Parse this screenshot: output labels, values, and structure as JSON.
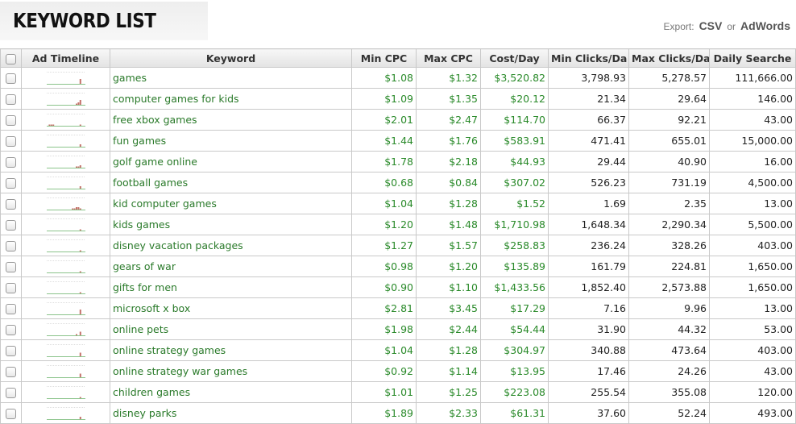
{
  "header": {
    "title": "KEYWORD LIST",
    "export_label": "Export:",
    "export_csv": "CSV",
    "export_or": "or",
    "export_adwords": "AdWords"
  },
  "columns": [
    "Ad Timeline",
    "Keyword",
    "Min CPC",
    "Max CPC",
    "Cost/Day",
    "Min Clicks/Da",
    "Max Clicks/Da",
    "Daily Searche"
  ],
  "rows": [
    {
      "keyword": "games",
      "min_cpc": "$1.08",
      "max_cpc": "$1.32",
      "cost_day": "$3,520.82",
      "min_clicks": "3,798.93",
      "max_clicks": "5,278.57",
      "daily": "111,666.00",
      "bars": [
        0,
        0,
        0,
        0,
        0,
        0,
        0,
        0,
        0,
        0,
        0,
        0,
        0,
        0,
        0,
        0,
        0,
        4,
        0,
        0
      ]
    },
    {
      "keyword": "computer games for kids",
      "min_cpc": "$1.09",
      "max_cpc": "$1.35",
      "cost_day": "$20.12",
      "min_clicks": "21.34",
      "max_clicks": "29.64",
      "daily": "146.00",
      "bars": [
        0,
        0,
        0,
        0,
        0,
        0,
        0,
        0,
        0,
        0,
        0,
        0,
        0,
        0,
        0,
        1,
        2,
        4,
        0,
        0
      ]
    },
    {
      "keyword": "free xbox games",
      "min_cpc": "$2.01",
      "max_cpc": "$2.47",
      "cost_day": "$114.70",
      "min_clicks": "66.37",
      "max_clicks": "92.21",
      "daily": "43.00",
      "bars": [
        0,
        1,
        1,
        1,
        0,
        0,
        0,
        0,
        0,
        0,
        0,
        0,
        0,
        0,
        0,
        0,
        0,
        1,
        0,
        0
      ]
    },
    {
      "keyword": "fun games",
      "min_cpc": "$1.44",
      "max_cpc": "$1.76",
      "cost_day": "$583.91",
      "min_clicks": "471.41",
      "max_clicks": "655.01",
      "daily": "15,000.00",
      "bars": [
        0,
        0,
        0,
        0,
        0,
        0,
        0,
        0,
        0,
        0,
        0,
        0,
        0,
        0,
        0,
        0,
        0,
        2,
        0,
        0
      ]
    },
    {
      "keyword": "golf game online",
      "min_cpc": "$1.78",
      "max_cpc": "$2.18",
      "cost_day": "$44.93",
      "min_clicks": "29.44",
      "max_clicks": "40.90",
      "daily": "16.00",
      "bars": [
        0,
        0,
        0,
        0,
        0,
        0,
        0,
        0,
        0,
        0,
        0,
        0,
        0,
        0,
        0,
        1,
        1,
        2,
        0,
        0
      ]
    },
    {
      "keyword": "football games",
      "min_cpc": "$0.68",
      "max_cpc": "$0.84",
      "cost_day": "$307.02",
      "min_clicks": "526.23",
      "max_clicks": "731.19",
      "daily": "4,500.00",
      "bars": [
        0,
        0,
        0,
        0,
        0,
        0,
        0,
        0,
        0,
        0,
        0,
        0,
        0,
        0,
        0,
        0,
        0,
        2,
        0,
        0
      ]
    },
    {
      "keyword": "kid computer games",
      "min_cpc": "$1.04",
      "max_cpc": "$1.28",
      "cost_day": "$1.52",
      "min_clicks": "1.69",
      "max_clicks": "2.35",
      "daily": "13.00",
      "bars": [
        0,
        0,
        0,
        0,
        0,
        0,
        0,
        0,
        0,
        0,
        0,
        0,
        0,
        1,
        1,
        2,
        2,
        1,
        0,
        0
      ]
    },
    {
      "keyword": "kids games",
      "min_cpc": "$1.20",
      "max_cpc": "$1.48",
      "cost_day": "$1,710.98",
      "min_clicks": "1,648.34",
      "max_clicks": "2,290.34",
      "daily": "5,500.00",
      "bars": [
        0,
        0,
        0,
        0,
        0,
        0,
        0,
        0,
        0,
        0,
        0,
        0,
        0,
        0,
        0,
        0,
        0,
        1,
        0,
        0
      ]
    },
    {
      "keyword": "disney vacation packages",
      "min_cpc": "$1.27",
      "max_cpc": "$1.57",
      "cost_day": "$258.83",
      "min_clicks": "236.24",
      "max_clicks": "328.26",
      "daily": "403.00",
      "bars": [
        0,
        0,
        0,
        0,
        0,
        0,
        0,
        0,
        0,
        0,
        0,
        0,
        0,
        0,
        0,
        0,
        0,
        1,
        0,
        0
      ]
    },
    {
      "keyword": "gears of war",
      "min_cpc": "$0.98",
      "max_cpc": "$1.20",
      "cost_day": "$135.89",
      "min_clicks": "161.79",
      "max_clicks": "224.81",
      "daily": "1,650.00",
      "bars": [
        0,
        0,
        0,
        0,
        0,
        0,
        0,
        0,
        0,
        0,
        0,
        0,
        0,
        0,
        0,
        0,
        0,
        1,
        0,
        0
      ]
    },
    {
      "keyword": "gifts for men",
      "min_cpc": "$0.90",
      "max_cpc": "$1.10",
      "cost_day": "$1,433.56",
      "min_clicks": "1,852.40",
      "max_clicks": "2,573.88",
      "daily": "1,650.00",
      "bars": [
        0,
        0,
        0,
        0,
        0,
        0,
        0,
        0,
        0,
        0,
        0,
        0,
        0,
        0,
        0,
        0,
        0,
        1,
        0,
        0
      ]
    },
    {
      "keyword": "microsoft x box",
      "min_cpc": "$2.81",
      "max_cpc": "$3.45",
      "cost_day": "$17.29",
      "min_clicks": "7.16",
      "max_clicks": "9.96",
      "daily": "13.00",
      "bars": [
        0,
        0,
        0,
        0,
        0,
        0,
        0,
        0,
        0,
        0,
        0,
        0,
        0,
        0,
        0,
        0,
        0,
        4,
        0,
        0
      ]
    },
    {
      "keyword": "online pets",
      "min_cpc": "$1.98",
      "max_cpc": "$2.44",
      "cost_day": "$54.44",
      "min_clicks": "31.90",
      "max_clicks": "44.32",
      "daily": "53.00",
      "bars": [
        0,
        0,
        0,
        0,
        0,
        0,
        0,
        0,
        0,
        0,
        0,
        0,
        0,
        0,
        0,
        1,
        0,
        3,
        0,
        0
      ]
    },
    {
      "keyword": "online strategy games",
      "min_cpc": "$1.04",
      "max_cpc": "$1.28",
      "cost_day": "$304.97",
      "min_clicks": "340.88",
      "max_clicks": "473.64",
      "daily": "403.00",
      "bars": [
        0,
        0,
        0,
        0,
        0,
        0,
        0,
        0,
        0,
        0,
        0,
        0,
        0,
        0,
        0,
        0,
        0,
        3,
        0,
        0
      ]
    },
    {
      "keyword": "online strategy war games",
      "min_cpc": "$0.92",
      "max_cpc": "$1.14",
      "cost_day": "$13.95",
      "min_clicks": "17.46",
      "max_clicks": "24.26",
      "daily": "43.00",
      "bars": [
        0,
        0,
        0,
        0,
        0,
        0,
        0,
        0,
        0,
        0,
        0,
        0,
        0,
        0,
        0,
        0,
        0,
        3,
        0,
        0
      ]
    },
    {
      "keyword": "children games",
      "min_cpc": "$1.01",
      "max_cpc": "$1.25",
      "cost_day": "$223.08",
      "min_clicks": "255.54",
      "max_clicks": "355.08",
      "daily": "120.00",
      "bars": [
        0,
        0,
        0,
        0,
        0,
        0,
        0,
        0,
        0,
        0,
        0,
        0,
        0,
        0,
        0,
        0,
        0,
        1,
        0,
        0
      ]
    },
    {
      "keyword": "disney parks",
      "min_cpc": "$1.89",
      "max_cpc": "$2.33",
      "cost_day": "$61.31",
      "min_clicks": "37.60",
      "max_clicks": "52.24",
      "daily": "493.00",
      "bars": [
        0,
        0,
        0,
        0,
        0,
        0,
        0,
        0,
        0,
        0,
        0,
        0,
        0,
        0,
        0,
        0,
        0,
        2,
        0,
        0
      ]
    }
  ],
  "colors": {
    "link_green": "#2a8a2a",
    "bar": "#c4736a",
    "baseline": "#8bc48b"
  }
}
